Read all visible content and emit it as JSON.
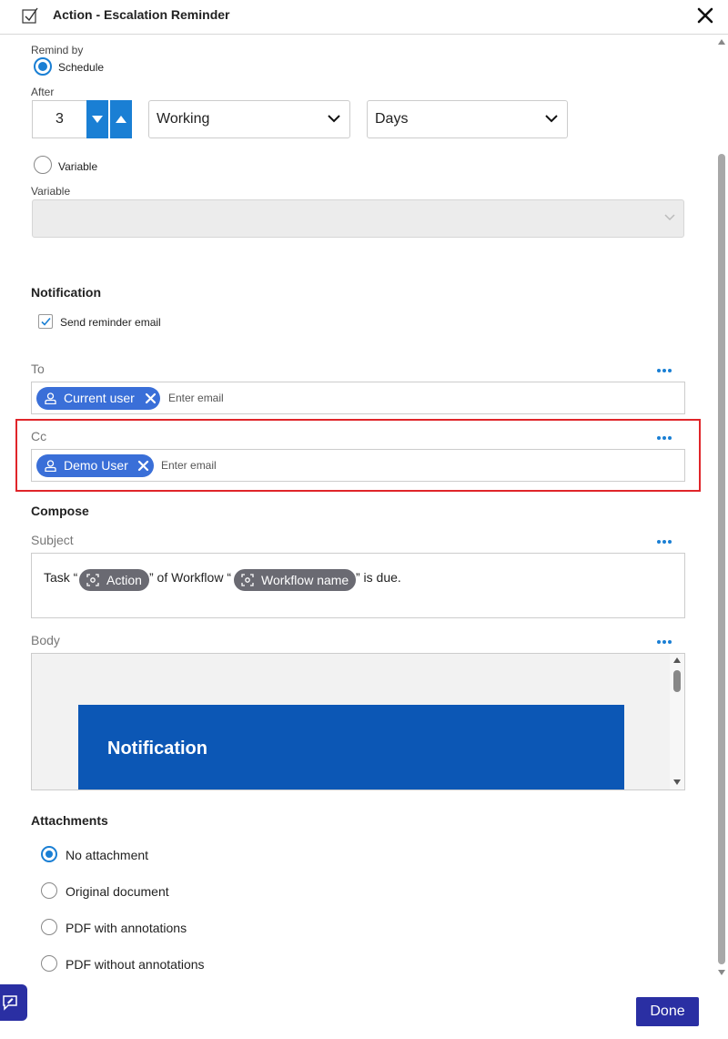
{
  "header": {
    "title": "Action - Escalation Reminder",
    "icon": "checkbox-edit-icon",
    "close_icon": "close-icon"
  },
  "remind": {
    "label": "Remind by",
    "schedule_label": "Schedule",
    "schedule_selected": true,
    "after_label": "After",
    "after_value": "3",
    "unit_type": "Working",
    "unit": "Days",
    "variable_label": "Variable",
    "variable_selected": false,
    "variable_field_label": "Variable",
    "variable_value": ""
  },
  "notification": {
    "title": "Notification",
    "send_reminder_label": "Send reminder email",
    "send_reminder_checked": true
  },
  "to": {
    "label": "To",
    "chips": [
      "Current user"
    ],
    "placeholder": "Enter email"
  },
  "cc": {
    "label": "Cc",
    "chips": [
      "Demo User"
    ],
    "placeholder": "Enter email"
  },
  "compose": {
    "title": "Compose",
    "subject_label": "Subject",
    "subject": {
      "part1": "Task “",
      "tag1": "Action",
      "part2": "” of Workflow “",
      "tag2": "Workflow name",
      "part3": "” is due."
    },
    "body_label": "Body",
    "body_banner": "Notification"
  },
  "attachments": {
    "title": "Attachments",
    "options": [
      "No attachment",
      "Original document",
      "PDF with annotations",
      "PDF without annotations"
    ],
    "selected": "No attachment"
  },
  "footer": {
    "done_label": "Done",
    "feedback_icon": "feedback-icon"
  },
  "colors": {
    "accent": "#1a7fd4",
    "chip": "#3a6fd8",
    "primary_button": "#2a2fa3",
    "banner": "#0c57b5",
    "highlight": "#e0252a"
  }
}
